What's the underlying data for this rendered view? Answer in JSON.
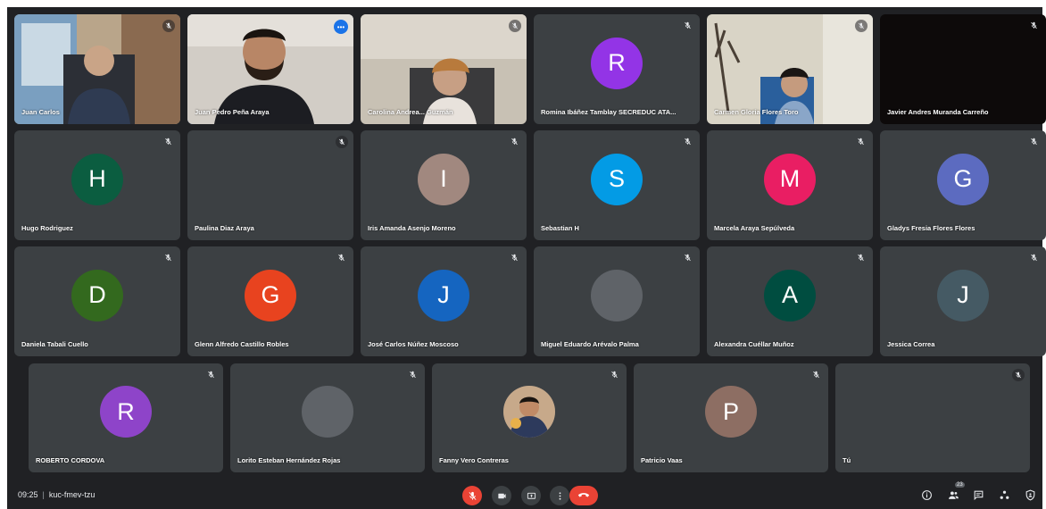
{
  "meeting": {
    "time": "09:25",
    "code": "kuc-fmev-tzu"
  },
  "colors": {
    "background": "#202124",
    "tile": "#3c4043",
    "red": "#ea4335",
    "speaking_blue": "#1a73e8"
  },
  "participants": [
    {
      "name": "Juan Carlos",
      "type": "video",
      "mic": "muted-bubble"
    },
    {
      "name": "Juan Pedro Peña Araya",
      "type": "video",
      "mic": "speaking"
    },
    {
      "name": "Carolina Andrea... Guzmán",
      "type": "video",
      "mic": "muted-bubble"
    },
    {
      "name": "Romina Ibáñez Tamblay SECREDUC ATA...",
      "type": "avatar",
      "initial": "R",
      "color": "#9334e6",
      "mic": "muted"
    },
    {
      "name": "Carmen Gloria Flores Toro",
      "type": "video",
      "mic": "muted-bubble"
    },
    {
      "name": "Javier Andres Muranda Carreño",
      "type": "dark",
      "mic": "muted"
    },
    {
      "name": "Hugo Rodriguez",
      "type": "avatar",
      "initial": "H",
      "color": "#0b5d40",
      "mic": "muted"
    },
    {
      "name": "Paulina Diaz Araya",
      "type": "video",
      "mic": "muted-bubble"
    },
    {
      "name": "Iris Amanda Asenjo Moreno",
      "type": "avatar",
      "initial": "I",
      "color": "#a1887f",
      "mic": "muted"
    },
    {
      "name": "Sebastian H",
      "type": "avatar",
      "initial": "S",
      "color": "#039be5",
      "mic": "muted"
    },
    {
      "name": "Marcela Araya Sepúlveda",
      "type": "avatar",
      "initial": "M",
      "color": "#e91e63",
      "mic": "muted"
    },
    {
      "name": "Gladys Fresia Flores Flores",
      "type": "avatar",
      "initial": "G",
      "color": "#5c6bc0",
      "mic": "muted"
    },
    {
      "name": "Daniela Tabali Cuello",
      "type": "avatar",
      "initial": "D",
      "color": "#33691e",
      "mic": "muted"
    },
    {
      "name": "Glenn Alfredo Castillo Robles",
      "type": "avatar",
      "initial": "G",
      "color": "#e8431f",
      "mic": "muted"
    },
    {
      "name": "José Carlos Núñez Moscoso",
      "type": "avatar",
      "initial": "J",
      "color": "#1565c0",
      "mic": "muted"
    },
    {
      "name": "Miguel Eduardo Arévalo Palma",
      "type": "photo",
      "mic": "muted"
    },
    {
      "name": "Alexandra Cuéllar Muñoz",
      "type": "avatar",
      "initial": "A",
      "color": "#004d40",
      "mic": "muted"
    },
    {
      "name": "Jessica Correa",
      "type": "avatar",
      "initial": "J",
      "color": "#455a64",
      "mic": "muted"
    },
    {
      "name": "ROBERTO CORDOVA",
      "type": "avatar",
      "initial": "R",
      "color": "#8e44c9",
      "mic": "muted"
    },
    {
      "name": "Lorito Esteban Hernández Rojas",
      "type": "photo",
      "mic": "muted"
    },
    {
      "name": "Fanny Vero Contreras",
      "type": "photo",
      "mic": "muted"
    },
    {
      "name": "Patricio Vaas",
      "type": "avatar",
      "initial": "P",
      "color": "#8d6e63",
      "mic": "muted"
    },
    {
      "name": "Tú",
      "type": "video",
      "mic": "muted-bubble"
    }
  ],
  "toolbar": {
    "participant_count": "23",
    "left_controls": [
      "mic-off-icon",
      "camera-icon",
      "present-icon",
      "more-vert-icon"
    ],
    "end_call": "call-end-icon",
    "right_controls": [
      "info-icon",
      "people-icon",
      "chat-icon",
      "activities-icon",
      "shield-icon"
    ]
  }
}
